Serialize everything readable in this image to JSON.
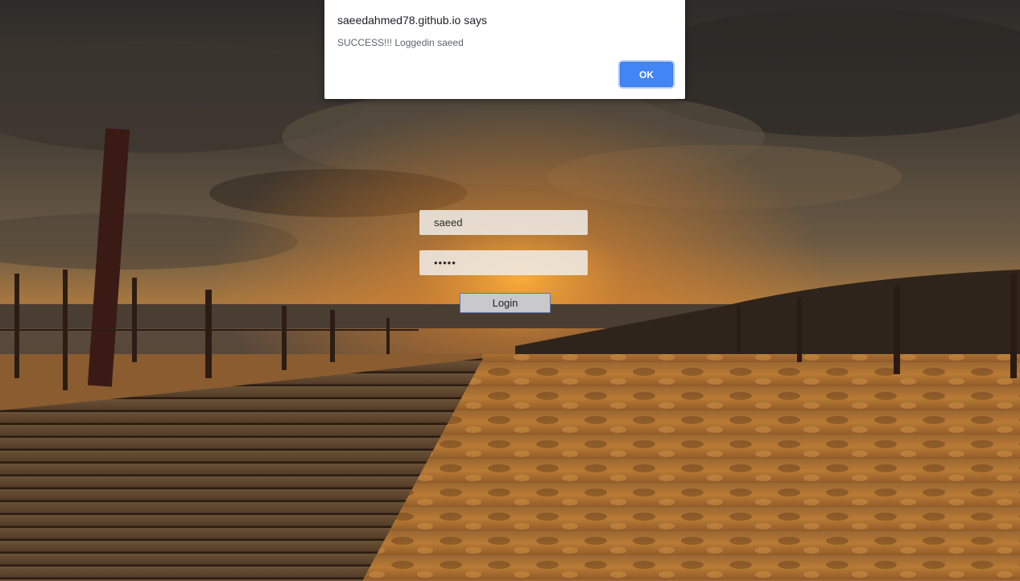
{
  "colors": {
    "accent": "#4285f4",
    "sky_dark": "#2f2c28",
    "sunset_glow": "#f09a32",
    "sand": "#b7762e",
    "boardwalk": "#6b4a2e"
  },
  "background": {
    "icon": "beach-sunset-image"
  },
  "login": {
    "username_value": "saeed",
    "password_value": "saeed",
    "button_label": "Login"
  },
  "alert": {
    "title": "saeedahmed78.github.io says",
    "message": "SUCCESS!!! Loggedin saeed",
    "ok_label": "OK"
  }
}
